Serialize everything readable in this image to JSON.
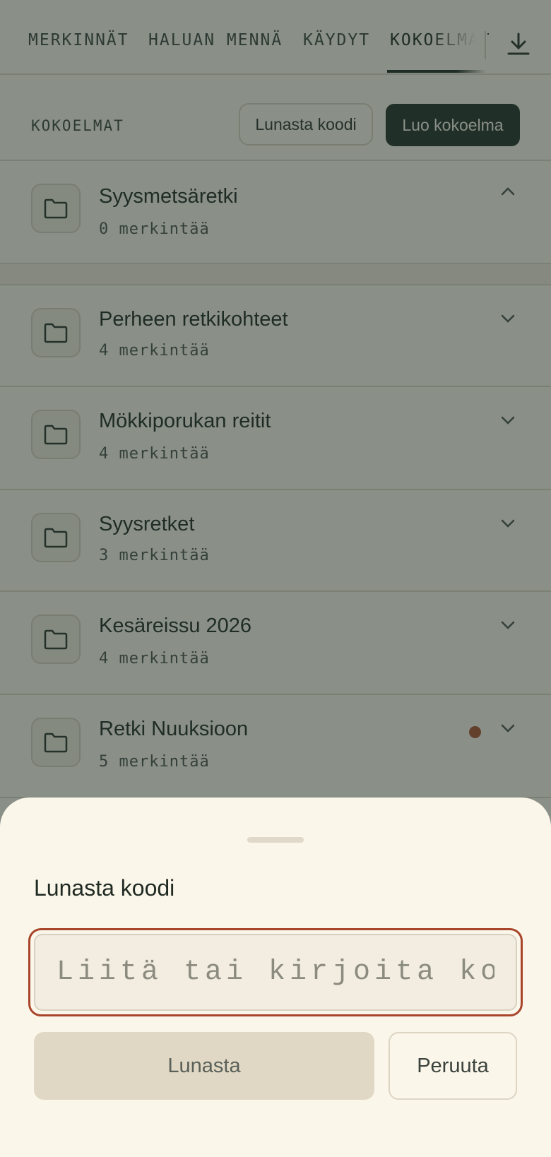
{
  "tabs": [
    {
      "label": "MERKINNÄT",
      "active": false
    },
    {
      "label": "HALUAN MENNÄ",
      "active": false
    },
    {
      "label": "KÄYDYT",
      "active": false
    },
    {
      "label": "KOKOELMAT",
      "active": true
    }
  ],
  "toolbar": {
    "download_icon": "download-icon",
    "section_label": "KOKOELMAT",
    "redeem_label": "Lunasta koodi",
    "create_label": "Luo kokoelma"
  },
  "collections": [
    {
      "title": "Syysmetsäretki",
      "count": "0 merkintää",
      "expanded": true,
      "indicator": false
    },
    {
      "title": "Perheen retkikohteet",
      "count": "4 merkintää",
      "expanded": false,
      "indicator": false
    },
    {
      "title": "Mökkiporukan reitit",
      "count": "4 merkintää",
      "expanded": false,
      "indicator": false
    },
    {
      "title": "Syysretket",
      "count": "3 merkintää",
      "expanded": false,
      "indicator": false
    },
    {
      "title": "Kesäreissu 2026",
      "count": "4 merkintää",
      "expanded": false,
      "indicator": false
    },
    {
      "title": "Retki Nuuksioon",
      "count": "5 merkintää",
      "expanded": false,
      "indicator": true
    }
  ],
  "sheet": {
    "title": "Lunasta koodi",
    "input_placeholder": "Liitä tai kirjoita koodi",
    "input_value": "",
    "submit_label": "Lunasta",
    "cancel_label": "Peruuta"
  },
  "colors": {
    "accent_dark": "#223026",
    "focus_ring": "#a8452b",
    "indicator_dot": "#a9532e",
    "sheet_background": "#fbf6ea"
  }
}
